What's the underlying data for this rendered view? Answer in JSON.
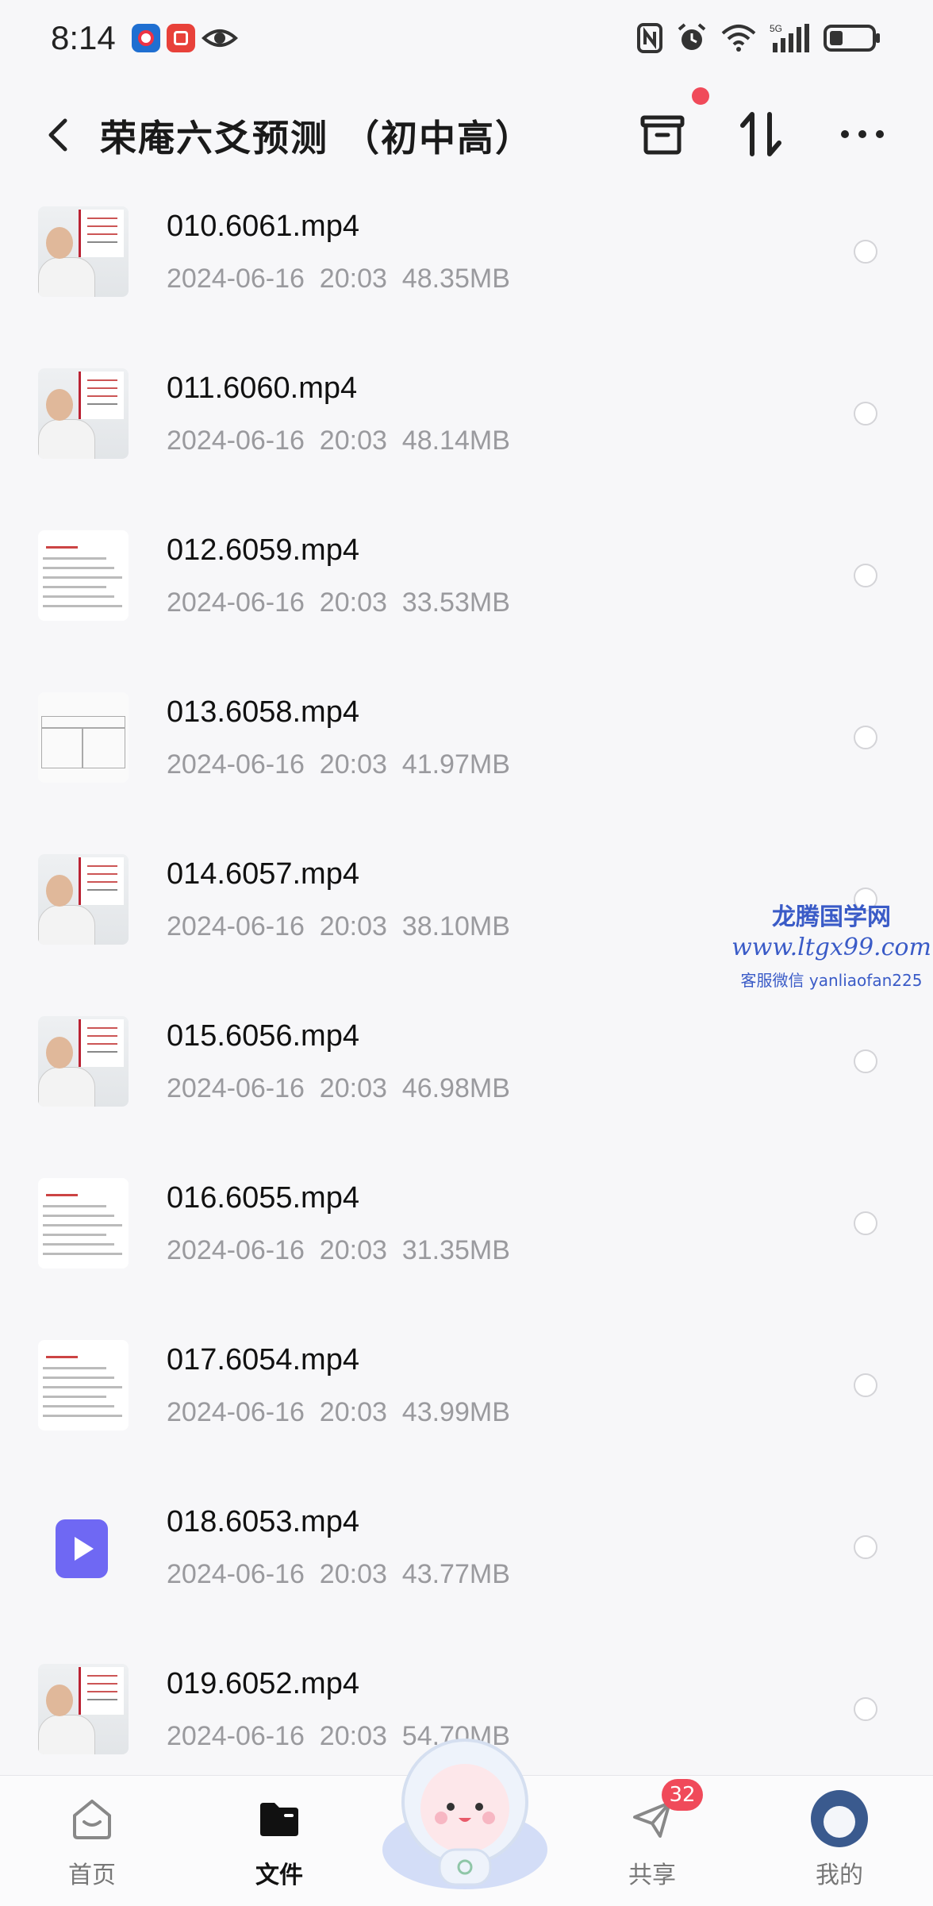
{
  "status_bar": {
    "time": "8:14",
    "left_icons": [
      "app-notification-icon",
      "app-notification-icon",
      "eye-icon"
    ],
    "right_icons": [
      "nfc-icon",
      "alarm-icon",
      "wifi-icon",
      "signal-5g-icon",
      "battery-icon"
    ]
  },
  "header": {
    "title": "荣庵六爻预测 （初中高）",
    "actions": [
      "archive-icon",
      "sort-icon",
      "more-icon"
    ],
    "has_notification_dot": true
  },
  "files": [
    {
      "name": "010.6061.mp4",
      "date": "2024-06-16",
      "time": "20:03",
      "size": "48.35MB",
      "meta": "2024-06-16  20:03  48.35MB",
      "thumb": "person"
    },
    {
      "name": "011.6060.mp4",
      "date": "2024-06-16",
      "time": "20:03",
      "size": "48.14MB",
      "meta": "2024-06-16  20:03  48.14MB",
      "thumb": "person"
    },
    {
      "name": "012.6059.mp4",
      "date": "2024-06-16",
      "time": "20:03",
      "size": "33.53MB",
      "meta": "2024-06-16  20:03  33.53MB",
      "thumb": "doc"
    },
    {
      "name": "013.6058.mp4",
      "date": "2024-06-16",
      "time": "20:03",
      "size": "41.97MB",
      "meta": "2024-06-16  20:03  41.97MB",
      "thumb": "table"
    },
    {
      "name": "014.6057.mp4",
      "date": "2024-06-16",
      "time": "20:03",
      "size": "38.10MB",
      "meta": "2024-06-16  20:03  38.10MB",
      "thumb": "person"
    },
    {
      "name": "015.6056.mp4",
      "date": "2024-06-16",
      "time": "20:03",
      "size": "46.98MB",
      "meta": "2024-06-16  20:03  46.98MB",
      "thumb": "person"
    },
    {
      "name": "016.6055.mp4",
      "date": "2024-06-16",
      "time": "20:03",
      "size": "31.35MB",
      "meta": "2024-06-16  20:03  31.35MB",
      "thumb": "doc"
    },
    {
      "name": "017.6054.mp4",
      "date": "2024-06-16",
      "time": "20:03",
      "size": "43.99MB",
      "meta": "2024-06-16  20:03  43.99MB",
      "thumb": "doc"
    },
    {
      "name": "018.6053.mp4",
      "date": "2024-06-16",
      "time": "20:03",
      "size": "43.77MB",
      "meta": "2024-06-16  20:03  43.77MB",
      "thumb": "video"
    },
    {
      "name": "019.6052.mp4",
      "date": "2024-06-16",
      "time": "20:03",
      "size": "54.70MB",
      "meta": "2024-06-16  20:03  54.70MB",
      "thumb": "person"
    }
  ],
  "watermark": {
    "title": "龙腾国学网",
    "url": "www.ltgx99.com",
    "contact": "客服微信 yanliaofan225"
  },
  "bottom_nav": {
    "items": [
      {
        "label": "首页",
        "icon": "home-icon",
        "active": false
      },
      {
        "label": "文件",
        "icon": "folder-icon",
        "active": true
      },
      {
        "label": "共享",
        "icon": "share-icon",
        "active": false,
        "badge": "32"
      },
      {
        "label": "我的",
        "icon": "avatar-icon",
        "active": false
      }
    ],
    "center_icon": "mascot-icon"
  },
  "colors": {
    "accent": "#6f68f3",
    "badge": "#f04a5a",
    "meta_text": "#9a9a9e",
    "watermark": "#3a5bc7"
  }
}
